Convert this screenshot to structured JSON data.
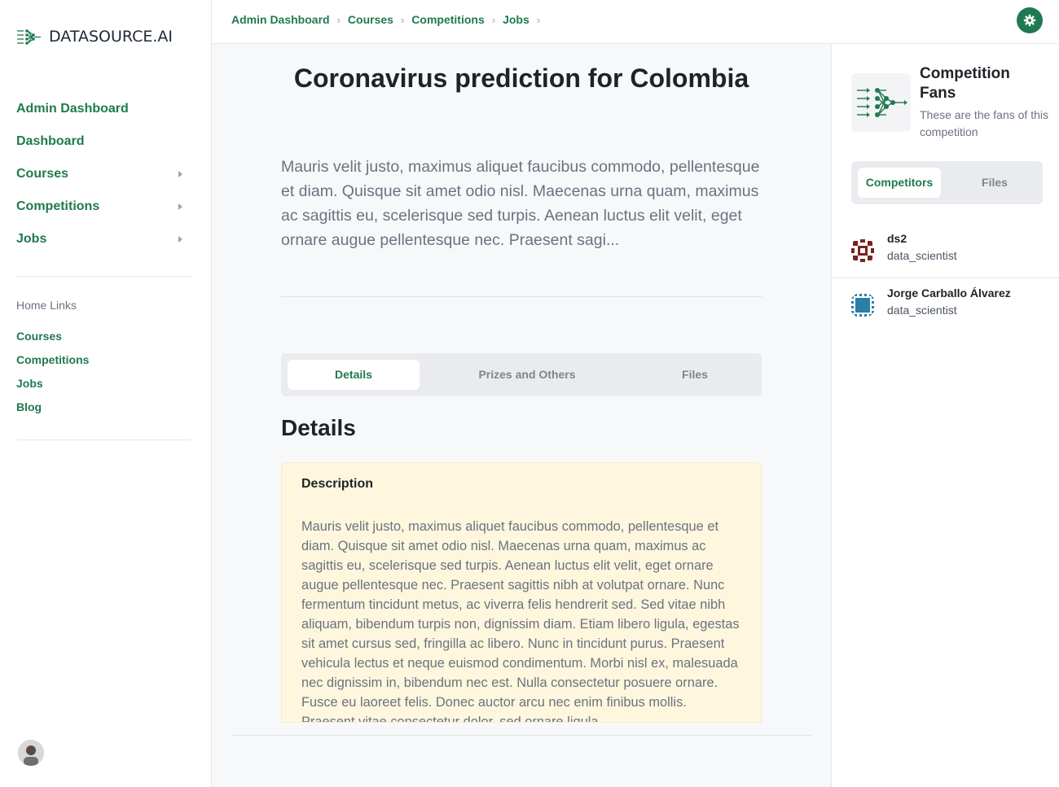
{
  "brand": {
    "logo_text": "DATASOURCE.AI",
    "accent": "#1f7a4f"
  },
  "sidebar": {
    "nav": [
      {
        "label": "Admin Dashboard",
        "has_caret": false
      },
      {
        "label": "Dashboard",
        "has_caret": false
      },
      {
        "label": "Courses",
        "has_caret": true
      },
      {
        "label": "Competitions",
        "has_caret": true
      },
      {
        "label": "Jobs",
        "has_caret": true
      }
    ],
    "home_links_title": "Home Links",
    "home_links": [
      "Courses",
      "Competitions",
      "Jobs",
      "Blog"
    ]
  },
  "breadcrumb": [
    "Admin Dashboard",
    "Courses",
    "Competitions",
    "Jobs"
  ],
  "main": {
    "title": "Coronavirus prediction for Colombia",
    "intro": "Mauris velit justo, maximus aliquet faucibus commodo, pellentesque et diam. Quisque sit amet odio nisl. Maecenas urna quam, maximus ac sagittis eu, scelerisque sed turpis. Aenean luctus elit velit, eget ornare augue pellentesque nec. Praesent sagi...",
    "tabs": [
      {
        "label": "Details",
        "active": true
      },
      {
        "label": "Prizes and Others",
        "active": false
      },
      {
        "label": "Files",
        "active": false
      }
    ],
    "section_heading": "Details",
    "description": {
      "title": "Description",
      "body": "Mauris velit justo, maximus aliquet faucibus commodo, pellentesque et diam. Quisque sit amet odio nisl. Maecenas urna quam, maximus ac sagittis eu, scelerisque sed turpis. Aenean luctus elit velit, eget ornare augue pellentesque nec. Praesent sagittis nibh at volutpat ornare. Nunc fermentum tincidunt metus, ac viverra felis hendrerit sed. Sed vitae nibh aliquam, bibendum turpis non, dignissim diam. Etiam libero ligula, egestas sit amet cursus sed, fringilla ac libero. Nunc in tincidunt purus. Praesent vehicula lectus et neque euismod condimentum. Morbi nisl ex, malesuada nec dignissim in, bibendum nec est. Nulla consectetur posuere ornare. Fusce eu laoreet felis. Donec auctor arcu nec enim finibus mollis. Praesent vitae consectetur dolor, sed ornare ligula."
    }
  },
  "right_panel": {
    "title": "Competition Fans",
    "subtitle": "These are the fans of this competition",
    "tabs": [
      {
        "label": "Competitors",
        "active": true
      },
      {
        "label": "Files",
        "active": false
      }
    ],
    "fans": [
      {
        "name": "ds2",
        "role": "data_scientist",
        "avatar_color": "#7a2320"
      },
      {
        "name": "Jorge Carballo Álvarez",
        "role": "data_scientist",
        "avatar_color": "#2a7fa8"
      }
    ]
  }
}
